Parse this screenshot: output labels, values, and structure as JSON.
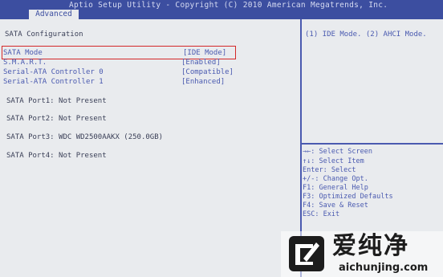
{
  "window": {
    "title": "Aptio Setup Utility - Copyright (C) 2010 American Megatrends, Inc."
  },
  "tabs": [
    {
      "label": "Advanced",
      "active": true
    }
  ],
  "main": {
    "section_title": "SATA Configuration",
    "options": [
      {
        "label": "SATA Mode",
        "value": "[IDE Mode]",
        "selected": true
      },
      {
        "label": "S.M.A.R.T.",
        "value": "[Enabled]"
      },
      {
        "label": "Serial-ATA Controller 0",
        "value": "[Compatible]"
      },
      {
        "label": "Serial-ATA Controller 1",
        "value": "[Enhanced]"
      }
    ],
    "ports": [
      "SATA Port1: Not Present",
      "SATA Port2: Not Present",
      "SATA Port3: WDC WD2500AAKX (250.0GB)",
      "SATA Port4: Not Present"
    ]
  },
  "help": {
    "text": "(1) IDE Mode. (2) AHCI Mode."
  },
  "keys": [
    "→←: Select Screen",
    "↑↓: Select Item",
    "Enter: Select",
    "+/-: Change Opt.",
    "F1: General Help",
    "F3: Optimized Defaults",
    "F4: Save & Reset",
    "ESC: Exit"
  ],
  "watermark": {
    "brand": "爱纯净",
    "url": "aichunjing.com"
  },
  "colors": {
    "header": "#3c4ea0",
    "accent": "#4a5ab0",
    "background": "#e9ebee",
    "selection_box": "#d42828"
  }
}
